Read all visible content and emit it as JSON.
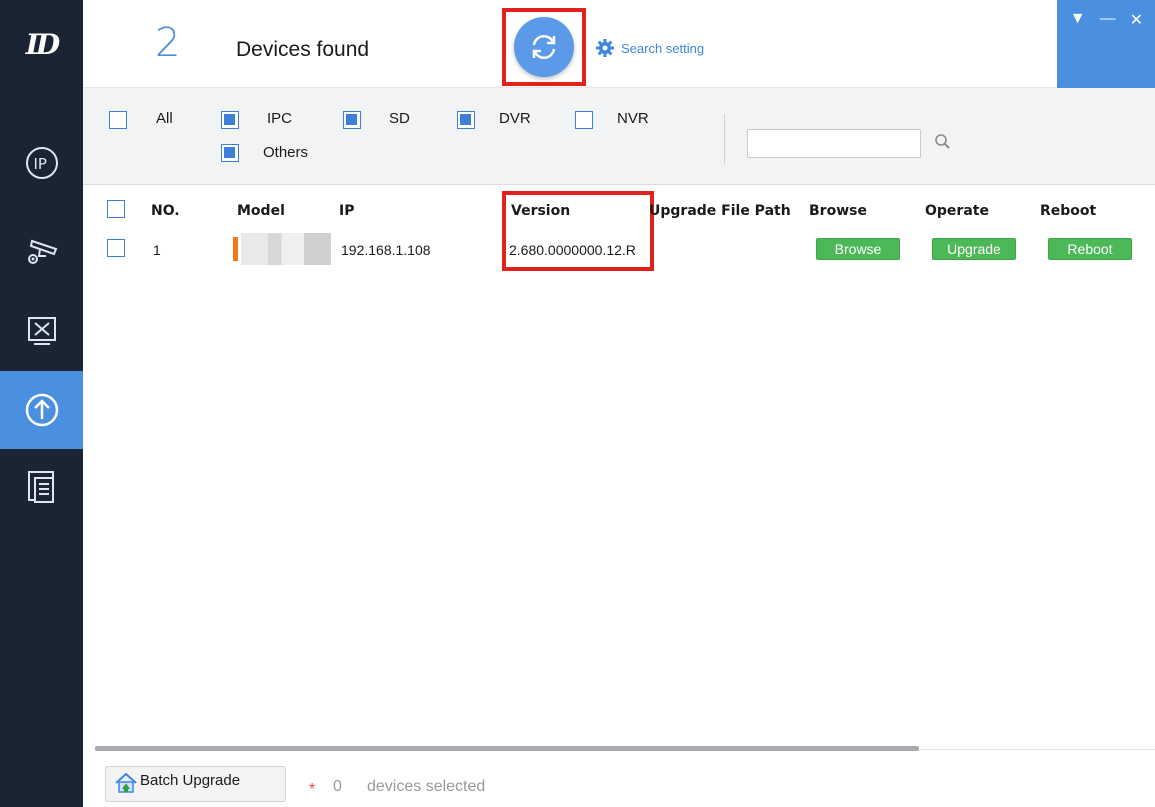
{
  "sidebar": {
    "logo_text": "ID",
    "items": [
      {
        "icon": "ip-icon",
        "active": false
      },
      {
        "icon": "camera-settings-icon",
        "active": false
      },
      {
        "icon": "tools-icon",
        "active": false
      },
      {
        "icon": "upgrade-icon",
        "active": true
      },
      {
        "icon": "document-list-icon",
        "active": false
      }
    ]
  },
  "header": {
    "device_count": "2",
    "devices_found_label": "Devices found",
    "search_setting_label": "Search setting"
  },
  "filters": {
    "all": {
      "label": "All",
      "checked": false
    },
    "ipc": {
      "label": "IPC",
      "checked": true
    },
    "sd": {
      "label": "SD",
      "checked": true
    },
    "dvr": {
      "label": "DVR",
      "checked": true
    },
    "nvr": {
      "label": "NVR",
      "checked": false
    },
    "others": {
      "label": "Others",
      "checked": true
    },
    "search_value": ""
  },
  "table": {
    "columns": {
      "no": "NO.",
      "model": "Model",
      "ip": "IP",
      "version": "Version",
      "upgrade_file_path": "Upgrade File Path",
      "browse": "Browse",
      "operate": "Operate",
      "reboot": "Reboot"
    },
    "rows": [
      {
        "no": "1",
        "model": "",
        "ip": "192.168.1.108",
        "version": "2.680.0000000.12.R",
        "upgrade_file_path": "",
        "browse_label": "Browse",
        "operate_label": "Upgrade",
        "reboot_label": "Reboot"
      }
    ]
  },
  "footer": {
    "batch_upgrade_label": "Batch Upgrade",
    "star": "*",
    "selected_count": "0",
    "selected_text": "devices selected"
  },
  "colors": {
    "sidebar_bg": "#1a2433",
    "accent_blue": "#4a8fe0",
    "highlight_red": "#e0211d",
    "button_green": "#4cb857",
    "model_marker_orange": "#f07a1a"
  }
}
